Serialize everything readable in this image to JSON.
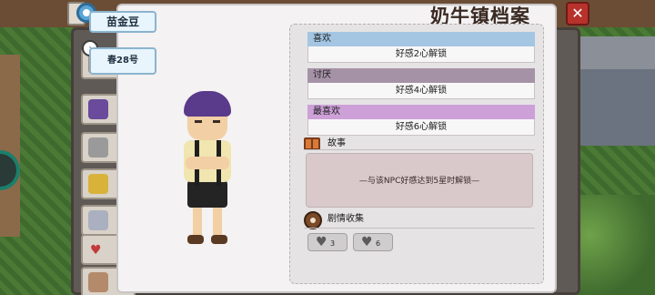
{
  "window": {
    "title": "奶牛镇档案",
    "close_label": "✕"
  },
  "npc": {
    "name": "苗金豆",
    "birthday": "春28号",
    "date_icon_glyph": "·"
  },
  "preferences": {
    "like": {
      "label": "喜欢",
      "value": "好感2心解锁"
    },
    "dislike": {
      "label": "讨厌",
      "value": "好感4心解锁"
    },
    "favorite": {
      "label": "最喜欢",
      "value": "好感6心解锁"
    }
  },
  "story": {
    "label": "故事",
    "locked_text": "—与该NPC好感达到5星时解锁—"
  },
  "collection": {
    "label": "剧情收集",
    "items": [
      {
        "icon": "heart-icon",
        "count": "3"
      },
      {
        "icon": "heart-icon",
        "count": "6"
      }
    ]
  },
  "background_list": {
    "heart_glyph": "♥"
  },
  "colors": {
    "like": "#a4c6e3",
    "dislike": "#a692a7",
    "favorite": "#cda0d8",
    "close": "#b8322c"
  }
}
